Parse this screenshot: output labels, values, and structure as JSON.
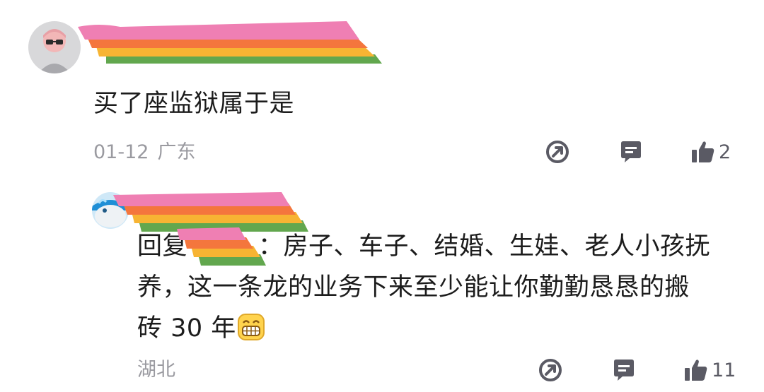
{
  "comments": [
    {
      "author_redacted": true,
      "avatar": "pink-cartoon-avatar",
      "text": "买了座监狱属于是",
      "date": "01-12",
      "location": "广东",
      "actions": {
        "share_icon": "share-icon",
        "reply_icon": "comment-icon",
        "like_icon": "thumbs-up-icon",
        "like_count": "2"
      }
    }
  ],
  "reply": {
    "author_redacted": true,
    "avatar": "blue-whale-avatar",
    "prefix": "回复",
    "line1_after": "：房子、车子、结婚、生娃、老人小孩抚",
    "line2": "养，这一条龙的业务下来至少能让你勤勤恳恳的搬",
    "line3": "砖 30 年",
    "emoji": "grinning-face-emoji",
    "location": "湖北",
    "actions": {
      "share_icon": "share-icon",
      "reply_icon": "comment-icon",
      "like_icon": "thumbs-up-icon",
      "like_count": "11"
    }
  },
  "colors": {
    "text": "#1c1c1c",
    "meta": "#9a9aa0",
    "icon": "#5a5a64",
    "redact_pink": "#ef7fb3",
    "redact_orange": "#f4763d",
    "redact_yellow": "#f7b433",
    "redact_green": "#62a74e"
  }
}
